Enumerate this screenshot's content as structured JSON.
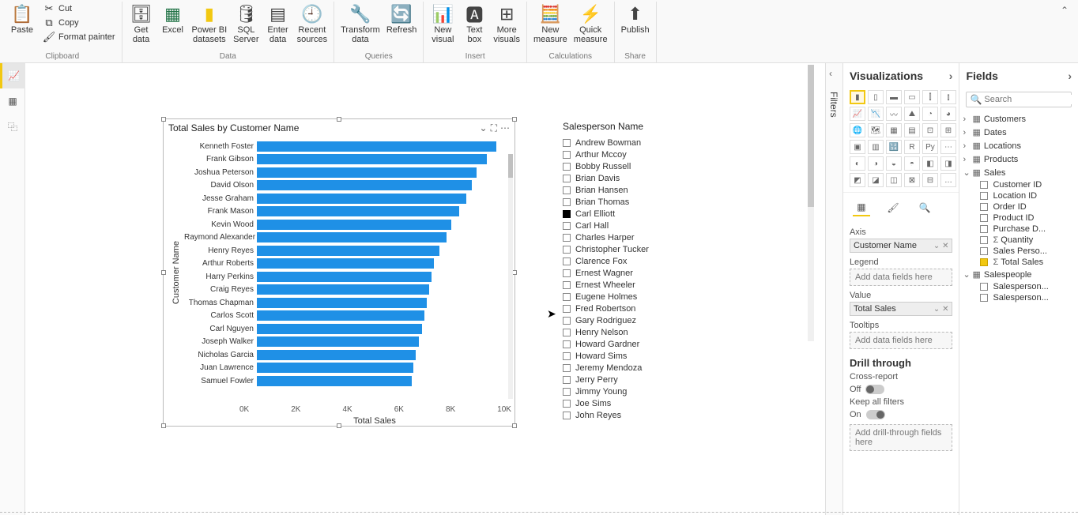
{
  "ribbon": {
    "clipboard": {
      "paste": "Paste",
      "cut": "Cut",
      "copy": "Copy",
      "format_painter": "Format painter",
      "group": "Clipboard"
    },
    "data": {
      "get_data": "Get\ndata",
      "excel": "Excel",
      "pbi_datasets": "Power BI\ndatasets",
      "sql": "SQL\nServer",
      "enter_data": "Enter\ndata",
      "recent_sources": "Recent\nsources",
      "group": "Data"
    },
    "queries": {
      "transform": "Transform\ndata",
      "refresh": "Refresh",
      "group": "Queries"
    },
    "insert": {
      "new_visual": "New\nvisual",
      "text_box": "Text\nbox",
      "more_visuals": "More\nvisuals",
      "group": "Insert"
    },
    "calculations": {
      "new_measure": "New\nmeasure",
      "quick_measure": "Quick\nmeasure",
      "group": "Calculations"
    },
    "share": {
      "publish": "Publish",
      "group": "Share"
    }
  },
  "chart_data": {
    "type": "bar",
    "title": "Total Sales by Customer Name",
    "xlabel": "Total Sales",
    "ylabel": "Customer Name",
    "xlim": [
      0,
      10000
    ],
    "ticks": [
      "0K",
      "2K",
      "4K",
      "6K",
      "8K",
      "10K"
    ],
    "bars": [
      {
        "name": "Kenneth Foster",
        "value": 9600
      },
      {
        "name": "Frank Gibson",
        "value": 9200
      },
      {
        "name": "Joshua Peterson",
        "value": 8800
      },
      {
        "name": "David Olson",
        "value": 8600
      },
      {
        "name": "Jesse Graham",
        "value": 8400
      },
      {
        "name": "Frank Mason",
        "value": 8100
      },
      {
        "name": "Kevin Wood",
        "value": 7800
      },
      {
        "name": "Raymond Alexander",
        "value": 7600
      },
      {
        "name": "Henry Reyes",
        "value": 7300
      },
      {
        "name": "Arthur Roberts",
        "value": 7100
      },
      {
        "name": "Harry Perkins",
        "value": 7000
      },
      {
        "name": "Craig Reyes",
        "value": 6900
      },
      {
        "name": "Thomas Chapman",
        "value": 6800
      },
      {
        "name": "Carlos Scott",
        "value": 6700
      },
      {
        "name": "Carl Nguyen",
        "value": 6600
      },
      {
        "name": "Joseph Walker",
        "value": 6500
      },
      {
        "name": "Nicholas Garcia",
        "value": 6350
      },
      {
        "name": "Juan Lawrence",
        "value": 6250
      },
      {
        "name": "Samuel Fowler",
        "value": 6200
      }
    ]
  },
  "slicer": {
    "title": "Salesperson Name",
    "items": [
      {
        "name": "Andrew Bowman",
        "checked": false
      },
      {
        "name": "Arthur Mccoy",
        "checked": false
      },
      {
        "name": "Bobby Russell",
        "checked": false
      },
      {
        "name": "Brian Davis",
        "checked": false
      },
      {
        "name": "Brian Hansen",
        "checked": false
      },
      {
        "name": "Brian Thomas",
        "checked": false
      },
      {
        "name": "Carl Elliott",
        "checked": true
      },
      {
        "name": "Carl Hall",
        "checked": false
      },
      {
        "name": "Charles Harper",
        "checked": false
      },
      {
        "name": "Christopher Tucker",
        "checked": false
      },
      {
        "name": "Clarence Fox",
        "checked": false
      },
      {
        "name": "Ernest Wagner",
        "checked": false
      },
      {
        "name": "Ernest Wheeler",
        "checked": false
      },
      {
        "name": "Eugene Holmes",
        "checked": false
      },
      {
        "name": "Fred Robertson",
        "checked": false
      },
      {
        "name": "Gary Rodriguez",
        "checked": false
      },
      {
        "name": "Henry Nelson",
        "checked": false
      },
      {
        "name": "Howard Gardner",
        "checked": false
      },
      {
        "name": "Howard Sims",
        "checked": false
      },
      {
        "name": "Jeremy Mendoza",
        "checked": false
      },
      {
        "name": "Jerry Perry",
        "checked": false
      },
      {
        "name": "Jimmy Young",
        "checked": false
      },
      {
        "name": "Joe Sims",
        "checked": false
      },
      {
        "name": "John Reyes",
        "checked": false
      }
    ]
  },
  "viz_panel": {
    "title": "Visualizations",
    "wells": {
      "axis": {
        "label": "Axis",
        "pill": "Customer Name"
      },
      "legend": {
        "label": "Legend",
        "placeholder": "Add data fields here"
      },
      "value": {
        "label": "Value",
        "pill": "Total Sales"
      },
      "tooltips": {
        "label": "Tooltips",
        "placeholder": "Add data fields here"
      }
    },
    "drill": {
      "header": "Drill through",
      "cross_report": "Cross-report",
      "off": "Off",
      "keep_filters": "Keep all filters",
      "on": "On",
      "placeholder": "Add drill-through fields here"
    }
  },
  "filters_label": "Filters",
  "fields_panel": {
    "title": "Fields",
    "search_placeholder": "Search",
    "tables": [
      {
        "name": "Customers",
        "expanded": false
      },
      {
        "name": "Dates",
        "expanded": false
      },
      {
        "name": "Locations",
        "expanded": false
      },
      {
        "name": "Products",
        "expanded": false
      },
      {
        "name": "Sales",
        "expanded": true,
        "fields": [
          {
            "name": "Customer ID",
            "checked": false
          },
          {
            "name": "Location ID",
            "checked": false
          },
          {
            "name": "Order ID",
            "checked": false
          },
          {
            "name": "Product ID",
            "checked": false
          },
          {
            "name": "Purchase D...",
            "checked": false
          },
          {
            "name": "Quantity",
            "checked": false,
            "sigma": true
          },
          {
            "name": "Sales Perso...",
            "checked": false
          },
          {
            "name": "Total Sales",
            "checked": true,
            "sigma": true
          }
        ]
      },
      {
        "name": "Salespeople",
        "expanded": true,
        "fields": [
          {
            "name": "Salesperson...",
            "checked": false
          },
          {
            "name": "Salesperson...",
            "checked": false
          }
        ]
      }
    ]
  }
}
